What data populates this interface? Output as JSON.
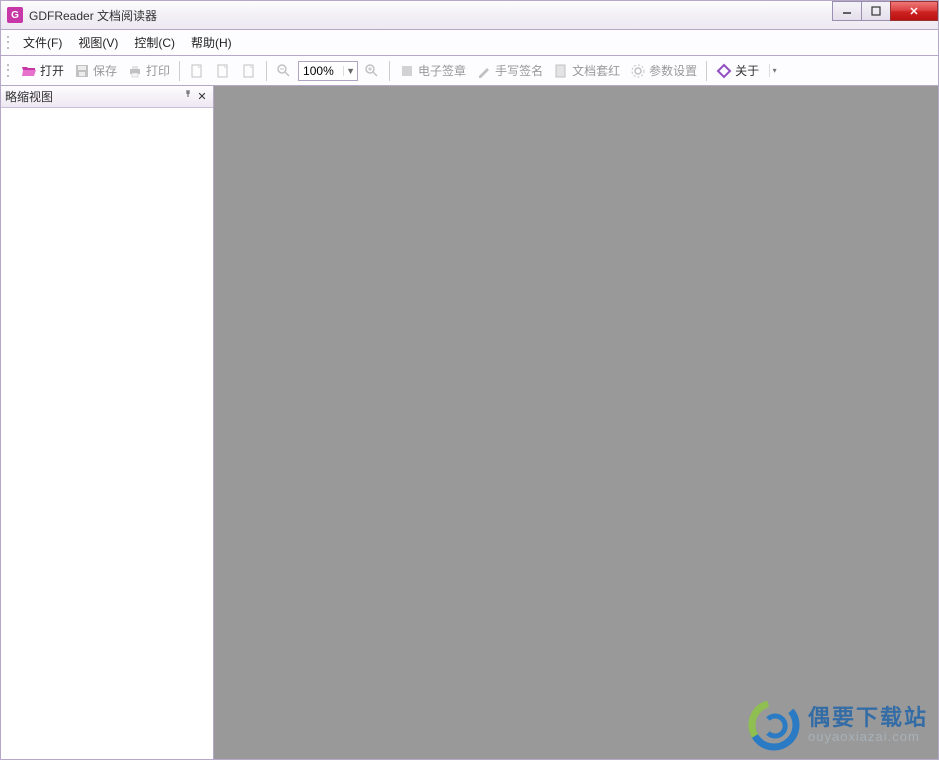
{
  "window": {
    "title": "GDFReader 文档阅读器"
  },
  "menu": {
    "file": "文件(F)",
    "view": "视图(V)",
    "control": "控制(C)",
    "help": "帮助(H)"
  },
  "toolbar": {
    "open": "打开",
    "save": "保存",
    "print": "打印",
    "zoom_value": "100%",
    "esig": "电子签章",
    "handwrite": "手写签名",
    "redhead": "文档套红",
    "params": "参数设置",
    "about": "关于"
  },
  "sidebar": {
    "title": "略缩视图"
  },
  "watermark": {
    "cn": "偶要下载站",
    "en": "ouyaoxiazai.com"
  }
}
